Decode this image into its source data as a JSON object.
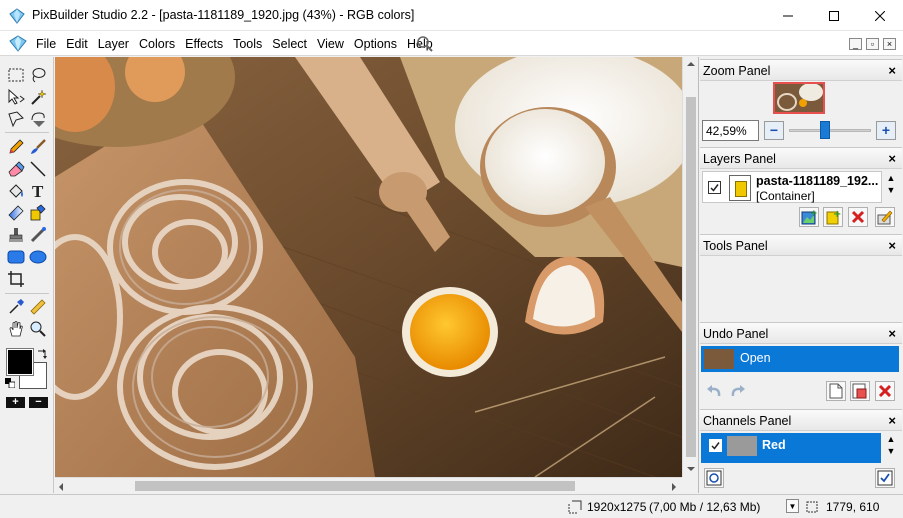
{
  "window": {
    "title": "PixBuilder Studio 2.2 - [pasta-1181189_1920.jpg (43%) - RGB colors]",
    "icons": [
      "app-diamond-icon",
      "minimize-icon",
      "maximize-icon",
      "close-icon"
    ]
  },
  "menu": {
    "items": [
      "File",
      "Edit",
      "Layer",
      "Colors",
      "Effects",
      "Tools",
      "Select",
      "View",
      "Options",
      "Help"
    ],
    "mdi_buttons": [
      "_",
      "▫",
      "×"
    ]
  },
  "toolbox": {
    "tools": [
      "rect-select-icon",
      "lasso-select-icon",
      "move-icon",
      "magic-wand-icon",
      "polygon-lasso-icon",
      "magnetic-lasso-icon",
      "pencil-icon",
      "brush-icon",
      "eraser-icon",
      "line-icon",
      "fill-bucket-icon",
      "text-icon",
      "gradient-icon",
      "color-replace-icon",
      "clone-stamp-icon",
      "retouch-icon",
      "rect-shape-icon",
      "ellipse-shape-icon",
      "crop-icon",
      "eyedropper-icon",
      "measure-icon",
      "hand-icon",
      "zoom-icon"
    ],
    "zoom_in": "+",
    "zoom_out": "−",
    "foreground_color": "#000000",
    "background_color": "#ffffff"
  },
  "panels": {
    "zoom": {
      "title": "Zoom Panel",
      "zoom_value": "42,59%",
      "zoom_out": "−",
      "zoom_in": "+",
      "slider_fraction": 0.43
    },
    "layers": {
      "title": "Layers Panel",
      "layer_name": "pasta-1181189_192...",
      "layer_type": "[Container]",
      "visible": true,
      "buttons": [
        "new-layer-from-image-icon",
        "new-layer-icon",
        "delete-layer-icon",
        "layer-properties-icon"
      ]
    },
    "tools": {
      "title": "Tools Panel"
    },
    "undo": {
      "title": "Undo Panel",
      "entry": "Open",
      "buttons": [
        "undo-icon",
        "redo-icon",
        "new-snapshot-icon",
        "new-document-from-state-icon",
        "delete-state-icon"
      ]
    },
    "channels": {
      "title": "Channels Panel",
      "channel": "Red",
      "visible": true,
      "buttons": [
        "channel-mask-icon",
        "channel-options-icon"
      ]
    },
    "close_glyph": "×"
  },
  "statusbar": {
    "size": "1920x1275",
    "memory": "(7,00 Mb / 12,63 Mb)",
    "cursor": "1779, 610"
  },
  "colors": {
    "accent": "#0a78d7",
    "wood": "#6b4a2c",
    "yolk": "#f0a000"
  }
}
